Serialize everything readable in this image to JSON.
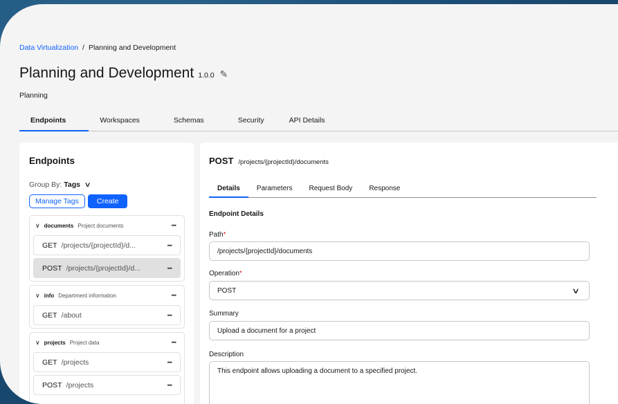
{
  "breadcrumb": {
    "root": "Data Virtualization",
    "separator": "/",
    "current": "Planning and Development"
  },
  "page": {
    "title": "Planning and Development",
    "version": "1.0.0",
    "subtitle": "Planning"
  },
  "tabs": [
    {
      "label": "Endpoints",
      "active": true
    },
    {
      "label": "Workspaces"
    },
    {
      "label": "Schemas"
    },
    {
      "label": "Security"
    },
    {
      "label": "API Details"
    }
  ],
  "left_panel": {
    "title": "Endpoints",
    "group_by_label": "Group By:",
    "group_by_value": "Tags",
    "manage_tags": "Manage Tags",
    "create": "Create",
    "groups": [
      {
        "name": "documents",
        "description": "Project documents",
        "items": [
          {
            "method": "GET",
            "path": "/projects/{projectId}/d..."
          },
          {
            "method": "POST",
            "path": "/projects/{projectId}/d...",
            "selected": true
          }
        ]
      },
      {
        "name": "info",
        "description": "Department information",
        "items": [
          {
            "method": "GET",
            "path": "/about"
          }
        ]
      },
      {
        "name": "projects",
        "description": "Project data",
        "items": [
          {
            "method": "GET",
            "path": "/projects"
          },
          {
            "method": "POST",
            "path": "/projects"
          }
        ]
      }
    ]
  },
  "detail": {
    "method": "POST",
    "path": "/projects/{projectId}/documents",
    "subtabs": [
      {
        "label": "Details",
        "active": true
      },
      {
        "label": "Parameters"
      },
      {
        "label": "Request Body"
      },
      {
        "label": "Response"
      }
    ],
    "section_title": "Endpoint Details",
    "path_label": "Path",
    "path_value": "/projects/{projectId}/documents",
    "operation_label": "Operation",
    "operation_value": "POST",
    "summary_label": "Summary",
    "summary_value": "Upload a document for a project",
    "description_label": "Description",
    "description_value": "This endpoint allows uploading a document to a specified project.",
    "required_marker": "*"
  },
  "icons": {
    "edit": "pencil-icon",
    "more": "overflow-menu-icon",
    "expand": "chevron-down-icon"
  },
  "colors": {
    "accent": "#0f62fe",
    "required": "#da1e28",
    "background": "#1c4f78"
  }
}
